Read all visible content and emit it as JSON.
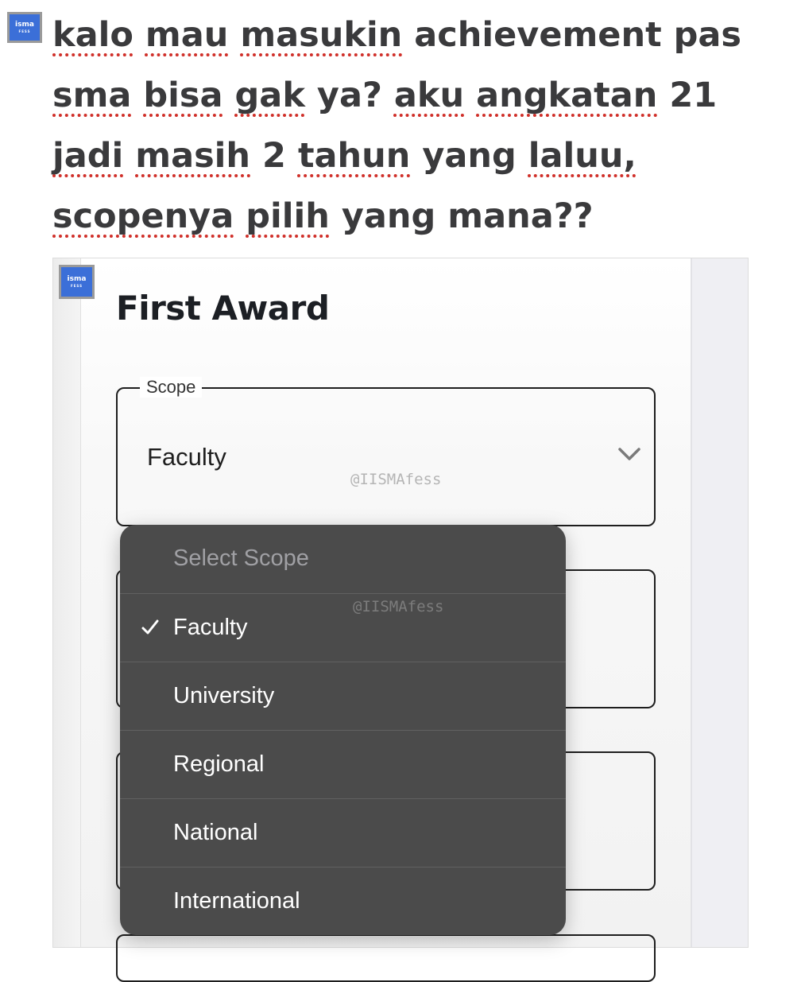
{
  "post": {
    "avatar_text": "isma",
    "avatar_subtext": "FESS",
    "words": [
      {
        "t": "kalo",
        "u": true
      },
      {
        "t": "mau",
        "u": true
      },
      {
        "t": "masukin",
        "u": true
      },
      {
        "t": "achievement",
        "u": false
      },
      {
        "t": "pas",
        "u": false
      },
      {
        "t": "sma",
        "u": true
      },
      {
        "t": "bisa",
        "u": true
      },
      {
        "t": "gak",
        "u": true
      },
      {
        "t": "ya?",
        "u": false
      },
      {
        "t": "aku",
        "u": true
      },
      {
        "t": "angkatan",
        "u": true
      },
      {
        "t": "21",
        "u": false
      },
      {
        "t": "jadi",
        "u": true
      },
      {
        "t": "masih",
        "u": true
      },
      {
        "t": "2",
        "u": false
      },
      {
        "t": "tahun",
        "u": true
      },
      {
        "t": "yang",
        "u": false
      },
      {
        "t": "laluu,",
        "u": true
      },
      {
        "t": "scopenya",
        "u": true
      },
      {
        "t": "pilih",
        "u": true
      },
      {
        "t": "yang",
        "u": false
      },
      {
        "t": "mana??",
        "u": false
      }
    ]
  },
  "screenshot": {
    "logo_text": "isma",
    "logo_subtext": "FESS",
    "card_title": "First Award",
    "scope_field": {
      "label": "Scope",
      "value": "Faculty"
    },
    "watermark": "@IISMAfess",
    "dropdown": {
      "placeholder": "Select Scope",
      "selected": "Faculty",
      "options": [
        "Faculty",
        "University",
        "Regional",
        "National",
        "International"
      ]
    }
  }
}
